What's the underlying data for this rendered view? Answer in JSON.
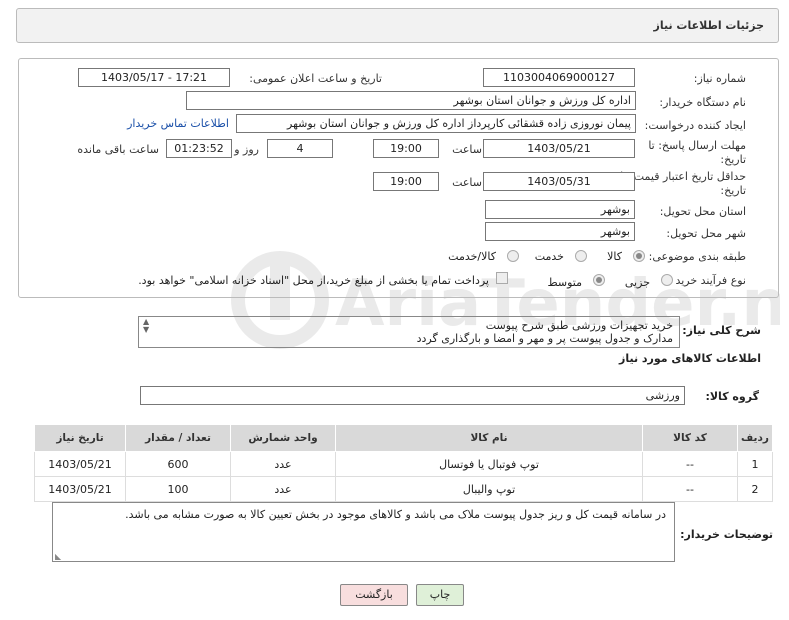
{
  "header": {
    "title": "جزئیات اطلاعات نیاز"
  },
  "form": {
    "need_number_label": "شماره نیاز:",
    "need_number": "1103004069000127",
    "announce_label": "تاریخ و ساعت اعلان عمومی:",
    "announce_value": "1403/05/17 - 17:21",
    "buyer_org_label": "نام دستگاه خریدار:",
    "buyer_org": "اداره کل ورزش و جوانان استان بوشهر",
    "creator_label": "ایجاد کننده درخواست:",
    "creator": "پیمان نوروزی زاده قشقائی کارپرداز اداره کل ورزش و جوانان استان بوشهر",
    "contact_link": "اطلاعات تماس خریدار",
    "deadline_label_1": "مهلت ارسال پاسخ: تا",
    "deadline_label_2": "تاریخ:",
    "deadline_date": "1403/05/21",
    "time_label": "ساعت",
    "deadline_time": "19:00",
    "days_value": "4",
    "days_label": "روز و",
    "remaining_time": "01:23:52",
    "remaining_label": "ساعت باقی مانده",
    "validity_label_1": "حداقل تاریخ اعتبار قیمت: تا",
    "validity_label_2": "تاریخ:",
    "validity_date": "1403/05/31",
    "validity_time": "19:00",
    "province_label": "استان محل تحویل:",
    "province": "بوشهر",
    "city_label": "شهر محل تحویل:",
    "city": "بوشهر",
    "category_label": "طبقه بندی موضوعی:",
    "category_options": [
      "کالا",
      "خدمت",
      "کالا/خدمت"
    ],
    "purchase_type_label": "نوع فرآیند خرید :",
    "purchase_options": [
      "جزیی",
      "متوسط"
    ],
    "payment_note": "پرداخت تمام یا بخشی از مبلغ خرید،از محل \"اسناد خزانه اسلامی\" خواهد بود."
  },
  "description": {
    "label": "شرح کلی نیاز:",
    "line1": "خرید تجهیزات ورزشی طبق شرح پیوست",
    "line2": "مدارک و جدول پیوست پر و مهر و امضا و بارگذاری گردد"
  },
  "goods": {
    "section_title": "اطلاعات کالاهای مورد نیاز",
    "group_label": "گروه کالا:",
    "group_value": "ورزشی",
    "columns": [
      "ردیف",
      "کد کالا",
      "نام کالا",
      "واحد شمارش",
      "تعداد / مقدار",
      "تاریخ نیاز"
    ],
    "rows": [
      [
        "1",
        "--",
        "توپ فوتبال یا فوتسال",
        "عدد",
        "600",
        "1403/05/21"
      ],
      [
        "2",
        "--",
        "توپ والیبال",
        "عدد",
        "100",
        "1403/05/21"
      ]
    ]
  },
  "buyer_notes": {
    "label": "توضیحات خریدار:",
    "text": "در سامانه قیمت کل و ریز جدول پیوست ملاک می باشد و کالاهای موجود در بخش تعیین کالا به صورت مشابه می باشد."
  },
  "buttons": {
    "print": "چاپ",
    "back": "بازگشت"
  },
  "watermark": "AriaTender.neT",
  "colors": {
    "header_bg": "#f2f2f2",
    "link": "#1a4fa8",
    "print_bg": "#dff0d8",
    "back_bg": "#f8dede"
  }
}
